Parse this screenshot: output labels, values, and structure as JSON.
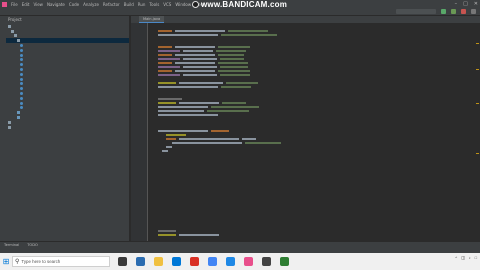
{
  "menubar": {
    "items": [
      "File",
      "Edit",
      "View",
      "Navigate",
      "Code",
      "Analyze",
      "Refactor",
      "Build",
      "Run",
      "Tools",
      "VCS",
      "Window",
      "Help"
    ]
  },
  "recorder": {
    "watermark": "www.BANDICAM.com"
  },
  "project_panel": {
    "title": "Project"
  },
  "editor": {
    "active_tab": "Main.java"
  },
  "bottom_tools": [
    "Terminal",
    "TODO"
  ],
  "taskbar": {
    "search_placeholder": "Type here to search"
  },
  "colors": {
    "editor_bg": "#2b2b2b",
    "panel_bg": "#3c3f41",
    "keyword": "#cc7832",
    "string": "#6a8759",
    "accent": "#4a88c7",
    "taskbar_bg": "#f0f0f0"
  }
}
